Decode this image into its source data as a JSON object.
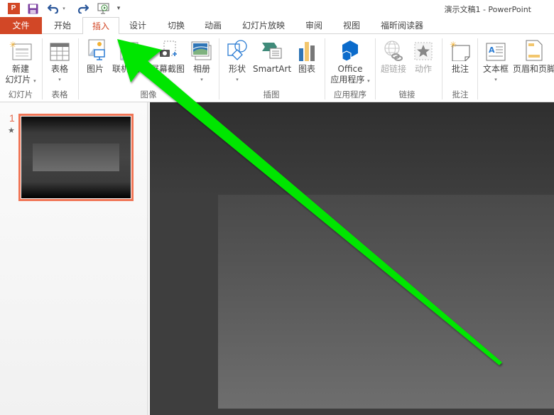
{
  "titlebar": {
    "app_logo": "P",
    "window_title": "演示文稿1 - PowerPoint",
    "qat": {
      "save": "save-icon",
      "undo": "undo-icon",
      "redo": "redo-icon",
      "present": "start-presentation-icon",
      "more": "▾"
    }
  },
  "tabs": [
    {
      "label": "文件"
    },
    {
      "label": "开始"
    },
    {
      "label": "插入",
      "active": true
    },
    {
      "label": "设计"
    },
    {
      "label": "切换"
    },
    {
      "label": "动画"
    },
    {
      "label": "幻灯片放映"
    },
    {
      "label": "审阅"
    },
    {
      "label": "视图"
    },
    {
      "label": "福昕阅读器"
    }
  ],
  "ribbon": {
    "groups": {
      "slides": "幻灯片",
      "tables": "表格",
      "images": "图像",
      "illustrations": "插图",
      "apps": "应用程序",
      "links": "链接",
      "comments": "批注"
    },
    "buttons": {
      "new_slide_line1": "新建",
      "new_slide_line2": "幻灯片",
      "table": "表格",
      "pictures": "图片",
      "online_pictures": "联机图片",
      "screenshot": "屏幕截图",
      "photo_album": "相册",
      "shapes": "形状",
      "smartart": "SmartArt",
      "chart": "图表",
      "office_apps_line1": "Office",
      "office_apps_line2": "应用程序",
      "hyperlink": "超链接",
      "action": "动作",
      "comment": "批注",
      "textbox": "文本框",
      "header_footer": "页眉和页脚"
    },
    "caret": "▾"
  },
  "slide_panel": {
    "slide_number": "1",
    "transition_marker": "★"
  },
  "colors": {
    "accent": "#d24726",
    "thumb_border": "#f07556",
    "annotation_arrow": "#00e600"
  }
}
